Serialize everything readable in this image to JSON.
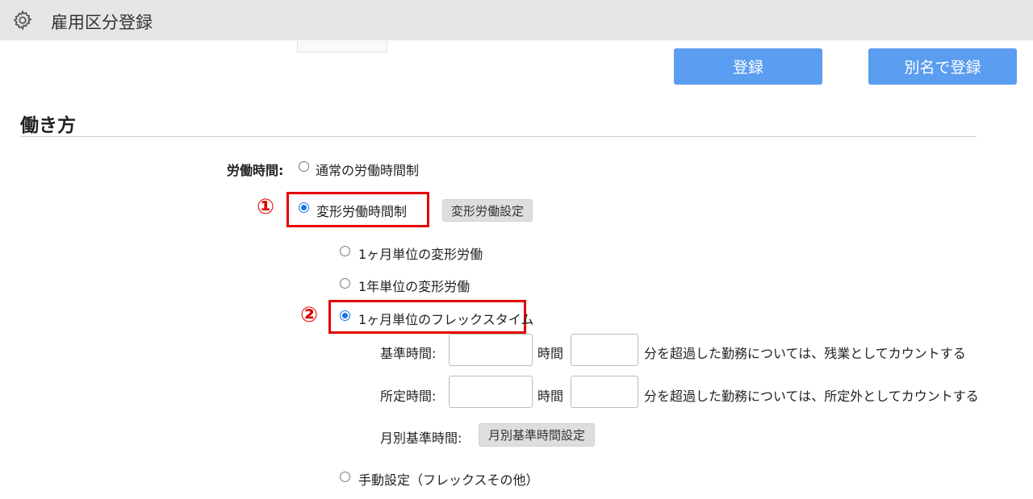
{
  "header": {
    "title": "雇用区分登録",
    "icon": "gear-icon"
  },
  "actions": {
    "register_label": "登録",
    "save_as_label": "別名で登録"
  },
  "section": {
    "title": "働き方"
  },
  "work_time": {
    "label": "労働時間:",
    "options": {
      "normal": "通常の労働時間制",
      "variable": "変形労働時間制",
      "monthly_variable": "1ヶ月単位の変形労働",
      "yearly_variable": "1年単位の変形労働",
      "monthly_flex": "1ヶ月単位のフレックスタイム",
      "manual": "手動設定（フレックスその他）"
    },
    "selected": [
      "variable",
      "monthly_flex"
    ],
    "variable_settings_button": "変形労働設定"
  },
  "flex": {
    "standard_label": "基準時間:",
    "standard_hours_unit": "時間",
    "standard_suffix": "分を超過した勤務については、残業としてカウントする",
    "scheduled_label": "所定時間:",
    "scheduled_hours_unit": "時間",
    "scheduled_suffix": "分を超過した勤務については、所定外としてカウントする",
    "monthly_label": "月別基準時間:",
    "monthly_button": "月別基準時間設定",
    "standard_hours": "",
    "standard_minutes": "",
    "scheduled_hours": "",
    "scheduled_minutes": ""
  },
  "annotations": {
    "marker1": "①",
    "marker2": "②",
    "color": "#e30000"
  },
  "colors": {
    "primary": "#5b9df0",
    "topbar": "#e6e6e6",
    "radio_selected": "#1a73e8"
  }
}
